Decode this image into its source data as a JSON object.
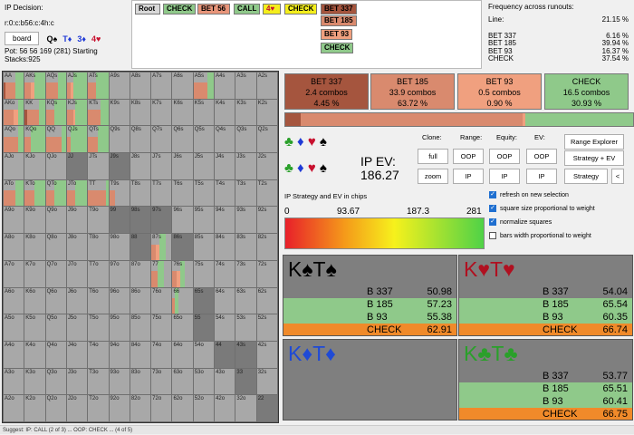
{
  "info": {
    "decision": "IP Decision:",
    "line": "r:0:c:b56:c:4h:c",
    "board_button": "board",
    "board_cards": [
      {
        "rank": "Q",
        "suit": "♠",
        "color": "#000000"
      },
      {
        "rank": "T",
        "suit": "♦",
        "color": "#1f3ad6"
      },
      {
        "rank": "3",
        "suit": "♦",
        "color": "#1f3ad6"
      },
      {
        "rank": "4",
        "suit": "♥",
        "color": "#c8102e"
      }
    ],
    "pot": "Pot: 56 56 169 (281) Starting Stacks:925"
  },
  "tree": {
    "nodes": [
      {
        "label": "Root",
        "bg": "#d9d9d9"
      },
      {
        "label": "CHECK",
        "bg": "#8fc98a"
      },
      {
        "label": "BET 56",
        "bg": "#e8957a"
      },
      {
        "label": "CALL",
        "bg": "#8fc98a"
      },
      {
        "label": "4♥",
        "bg": "#f4ee1c",
        "color": "#c8102e"
      },
      {
        "label": "CHECK",
        "bg": "#f4ee1c"
      },
      {
        "label": "BET 337",
        "bg": "#a5553e"
      },
      {
        "label": "BET 185",
        "bg": "#d98a6e"
      },
      {
        "label": "BET 93",
        "bg": "#f0a07f"
      },
      {
        "label": "CHECK",
        "bg": "#8fc98a"
      }
    ]
  },
  "frequency": {
    "title": "Frequency across runouts:",
    "line_label": "Line:",
    "line_value": "21.15 %",
    "rows": [
      {
        "name": "BET 337",
        "value": "6.16 %"
      },
      {
        "name": "BET 185",
        "value": "39.94 %"
      },
      {
        "name": "BET 93",
        "value": "16.37 %"
      },
      {
        "name": "CHECK",
        "value": "37.54 %"
      }
    ]
  },
  "grid": {
    "ranks": [
      "A",
      "K",
      "Q",
      "J",
      "T",
      "9",
      "8",
      "7",
      "6",
      "5",
      "4",
      "3",
      "2"
    ],
    "colors": {
      "bet_big": "#a5553e",
      "bet_mid": "#d98a6e",
      "bet_small": "#f0a07f",
      "check": "#8fc98a",
      "cell": "#a8a8a8",
      "blank": "#7a7a7a"
    }
  },
  "actions": [
    {
      "name": "BET 337",
      "combos": "2.4 combos",
      "pct": "4.45 %",
      "bg": "#a5553e",
      "freq": 4.45
    },
    {
      "name": "BET 185",
      "combos": "33.9 combos",
      "pct": "63.72 %",
      "bg": "#d98a6e",
      "freq": 63.72
    },
    {
      "name": "BET 93",
      "combos": "0.5 combos",
      "pct": "0.90 %",
      "bg": "#f0a07f",
      "freq": 0.9
    },
    {
      "name": "CHECK",
      "combos": "16.5 combos",
      "pct": "30.93 %",
      "bg": "#8fc98a",
      "freq": 30.93
    }
  ],
  "ev": {
    "label": "IP EV:",
    "value": "186.27"
  },
  "headers": {
    "clone": "Clone:",
    "range": "Range:",
    "equity": "Equity:",
    "ev": "EV:"
  },
  "buttons": {
    "full": "full",
    "zoom": "zoom",
    "range_oop": "OOP",
    "range_ip": "IP",
    "equity_oop": "OOP",
    "equity_ip": "IP",
    "ev_oop": "OOP",
    "ev_ip": "IP",
    "range_explorer": "Range Explorer",
    "strategy_ev": "Strategy + EV",
    "strategy": "Strategy",
    "back": "<"
  },
  "scale": {
    "title": "IP Strategy and EV in chips",
    "ticks": [
      "0",
      "93.67",
      "187.3",
      "281"
    ]
  },
  "options": [
    {
      "label": "refresh on new selection",
      "checked": true
    },
    {
      "label": "square size proportional to weight",
      "checked": true
    },
    {
      "label": "normalize squares",
      "checked": true
    },
    {
      "label": "bars width proportional to weight",
      "checked": false
    }
  ],
  "combos": [
    {
      "rank1": "K",
      "suit1": "♠",
      "rank2": "T",
      "suit2": "♠",
      "color": "#000000",
      "rows": [
        {
          "name": "B 337",
          "value": "50.98"
        },
        {
          "name": "B 185",
          "value": "57.23"
        },
        {
          "name": "B 93",
          "value": "55.38"
        },
        {
          "name": "CHECK",
          "value": "62.91"
        }
      ]
    },
    {
      "rank1": "K",
      "suit1": "♥",
      "rank2": "T",
      "suit2": "♥",
      "color": "#b01020",
      "rows": [
        {
          "name": "B 337",
          "value": "54.04"
        },
        {
          "name": "B 185",
          "value": "65.54"
        },
        {
          "name": "B 93",
          "value": "60.35"
        },
        {
          "name": "CHECK",
          "value": "66.74"
        }
      ]
    },
    {
      "rank1": "K",
      "suit1": "♦",
      "rank2": "T",
      "suit2": "♦",
      "color": "#1f4ad6",
      "rows": []
    },
    {
      "rank1": "K",
      "suit1": "♣",
      "rank2": "T",
      "suit2": "♣",
      "color": "#2aa02a",
      "rows": [
        {
          "name": "B 337",
          "value": "53.77"
        },
        {
          "name": "B 185",
          "value": "65.51"
        },
        {
          "name": "B 93",
          "value": "60.41"
        },
        {
          "name": "CHECK",
          "value": "66.75"
        }
      ]
    }
  ],
  "status": "Suggest: IP: CALL (2 of 3) ... OOP: CHECK ... (4 of 5)"
}
